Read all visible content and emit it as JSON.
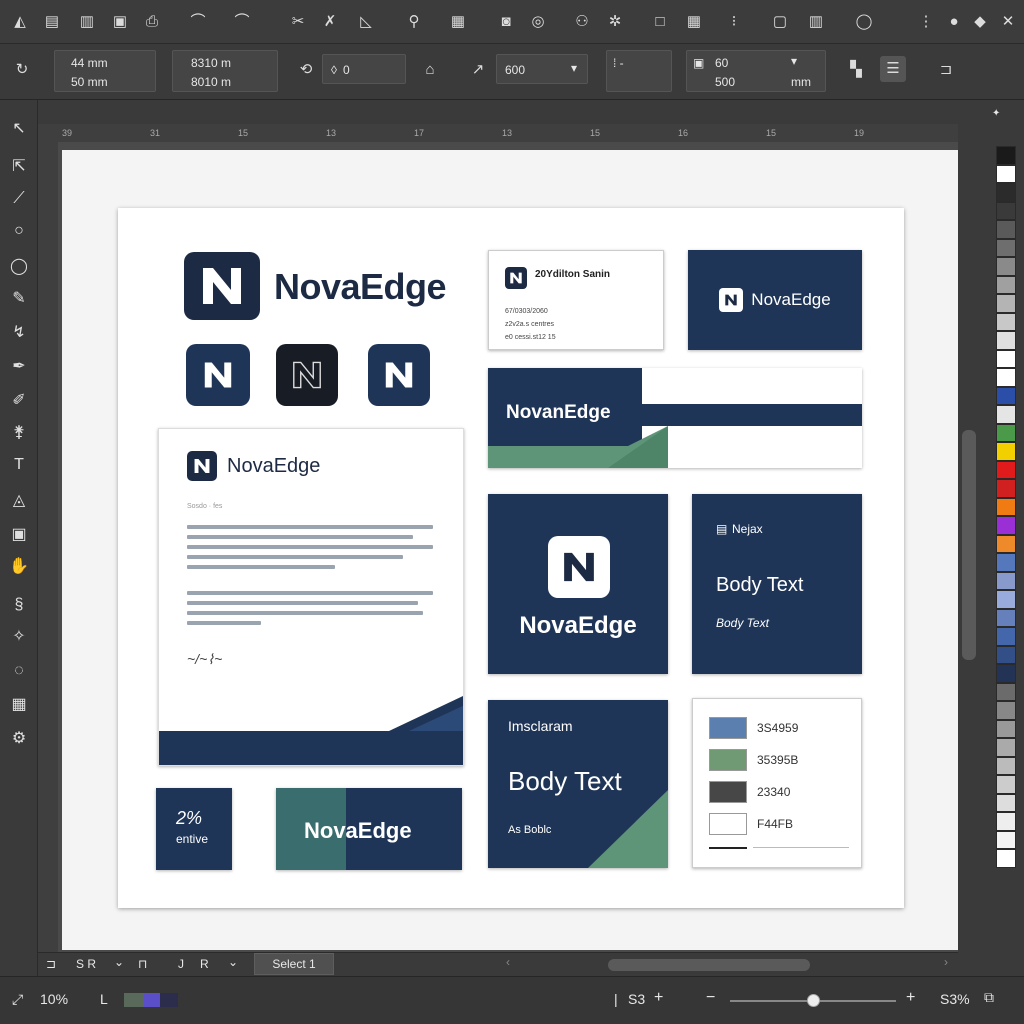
{
  "top_toolbar": {
    "icons": [
      "app-icon",
      "new-doc-icon",
      "open-icon",
      "save-icon",
      "print-icon",
      "curve-icon",
      "curve2-icon",
      "scissors-icon",
      "pointer-icon",
      "chart-icon",
      "step-icon",
      "grid-icon",
      "align-icon",
      "ring-icon",
      "node-icon",
      "snap-icon",
      "square-icon",
      "table-icon",
      "text-icon",
      "image-icon",
      "circle-icon",
      "more-icon",
      "minimize-icon",
      "close-icon"
    ]
  },
  "properties": {
    "width": "44 mm",
    "height": "50 mm",
    "x_pos": "8310 m",
    "y_pos": "8010 m",
    "rotation": "0",
    "stroke": "600",
    "dim_a": "60",
    "dim_b": "500",
    "unit": "mm"
  },
  "ruler_top_labels": [
    "39",
    "31",
    "15",
    "13",
    "17",
    "13",
    "15",
    "16",
    "15",
    "19"
  ],
  "brand": {
    "name": "NovaEdge",
    "business_card_name": "20Ydilton Sanin",
    "business_card_lines": [
      "67/0303/2060",
      "z2v2a.s centres",
      "e0 cessi.st12 15"
    ],
    "letter_heading": "NovaEdge",
    "letter_sub": "Sosdo · fes",
    "banner_text": "NovanEdge",
    "social_heading": "Nejax",
    "body_text": "Body Text",
    "body_text_small": "Body Text",
    "insta_heading": "Imsclaram",
    "insta_small": "As Boblc",
    "stat_value": "2%",
    "stat_label": "entive"
  },
  "palette_card": {
    "rows": [
      {
        "color": "#5b80b0",
        "hex": "3S4959"
      },
      {
        "color": "#6f9a74",
        "hex": "35395B"
      },
      {
        "color": "#474747",
        "hex": "23340"
      },
      {
        "color": "#ffffff",
        "hex": "F44FB"
      }
    ]
  },
  "swatches": [
    "#1a1a1a",
    "#ffffff",
    "#2b2b2b",
    "#3a3a3a",
    "#5a5a5a",
    "#6e6e6e",
    "#8a8a8a",
    "#a0a0a0",
    "#b4b4b4",
    "#c8c8c8",
    "#e0e0e0",
    "#ffffff",
    "#ffffff",
    "#2b4fa8",
    "#e5e5e5",
    "#4a9a4a",
    "#f2d000",
    "#e11b1b",
    "#d12020",
    "#f07b12",
    "#9a2fd6",
    "#ef8a2a",
    "#5577bb",
    "#8899cc",
    "#99aadd",
    "#6680bb",
    "#4466aa",
    "#334f88",
    "#223355",
    "#6b6b6b",
    "#888888",
    "#999999",
    "#aaaaaa",
    "#bbbbbb",
    "#cccccc",
    "#dddddd",
    "#eeeeee",
    "#f5f5f5",
    "#ffffff"
  ],
  "bottom_tabs": {
    "tab_label": "Select 1",
    "left_labels": [
      "S R",
      "J",
      "R"
    ]
  },
  "status": {
    "zoom": "10%",
    "layer_label": "L",
    "page_label": "S3",
    "zoom_right": "S3%",
    "slider_level": 0.5
  }
}
